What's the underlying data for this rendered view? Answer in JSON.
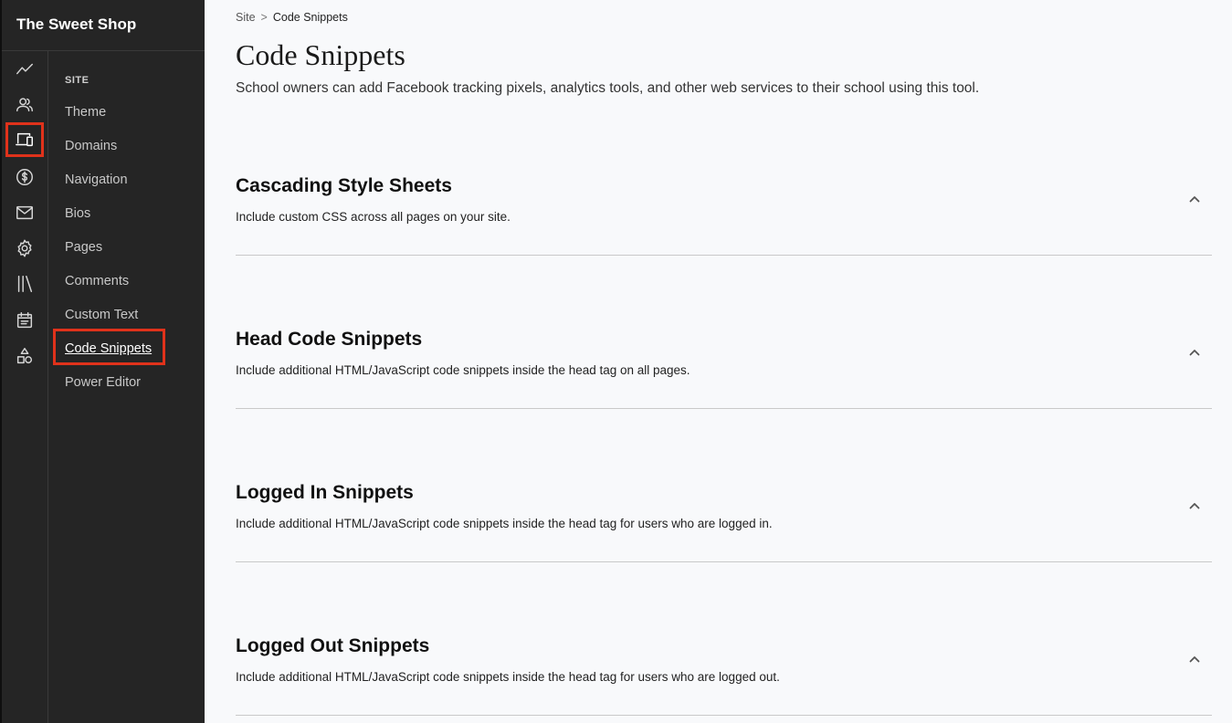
{
  "app": {
    "brand": "The Sweet Shop"
  },
  "rail": {
    "icons": [
      {
        "name": "analytics-icon"
      },
      {
        "name": "users-icon"
      },
      {
        "name": "site-devices-icon",
        "active": true
      },
      {
        "name": "sales-dollar-icon"
      },
      {
        "name": "emails-icon"
      },
      {
        "name": "settings-gear-icon"
      },
      {
        "name": "library-icon"
      },
      {
        "name": "calendar-icon"
      },
      {
        "name": "apps-shapes-icon"
      }
    ],
    "highlight_color": "#e0321b"
  },
  "subnav": {
    "heading": "SITE",
    "items": [
      {
        "label": "Theme"
      },
      {
        "label": "Domains"
      },
      {
        "label": "Navigation"
      },
      {
        "label": "Bios"
      },
      {
        "label": "Pages"
      },
      {
        "label": "Comments"
      },
      {
        "label": "Custom Text"
      },
      {
        "label": "Code Snippets",
        "active": true
      },
      {
        "label": "Power Editor"
      }
    ]
  },
  "breadcrumb": {
    "parent": "Site",
    "separator": ">",
    "current": "Code Snippets"
  },
  "page": {
    "title": "Code Snippets",
    "description": "School owners can add Facebook tracking pixels, analytics tools, and other web services to their school using this tool."
  },
  "sections": [
    {
      "title": "Cascading Style Sheets",
      "description": "Include custom CSS across all pages on your site."
    },
    {
      "title": "Head Code Snippets",
      "description": "Include additional HTML/JavaScript code snippets inside the head tag on all pages."
    },
    {
      "title": "Logged In Snippets",
      "description": "Include additional HTML/JavaScript code snippets inside the head tag for users who are logged in."
    },
    {
      "title": "Logged Out Snippets",
      "description": "Include additional HTML/JavaScript code snippets inside the head tag for users who are logged out."
    }
  ]
}
